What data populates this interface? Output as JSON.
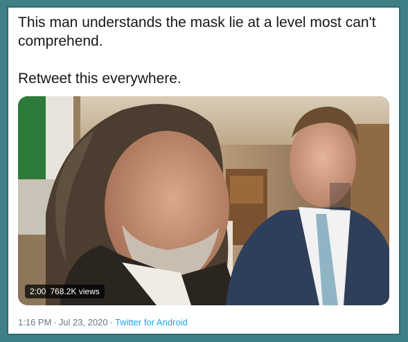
{
  "tweet": {
    "text": "This man understands the mask lie at a level most can't\ncomprehend.\n\nRetweet this everywhere.",
    "time": "1:16 PM",
    "date": "Jul 23, 2020",
    "source": "Twitter for Android",
    "separator": "·"
  },
  "video": {
    "duration": "2:00",
    "views": "768.2K views"
  },
  "colors": {
    "frame": "#3f7f86",
    "card": "#ffffff",
    "text": "#14171a",
    "meta": "#657786",
    "link": "#1da1f2"
  }
}
